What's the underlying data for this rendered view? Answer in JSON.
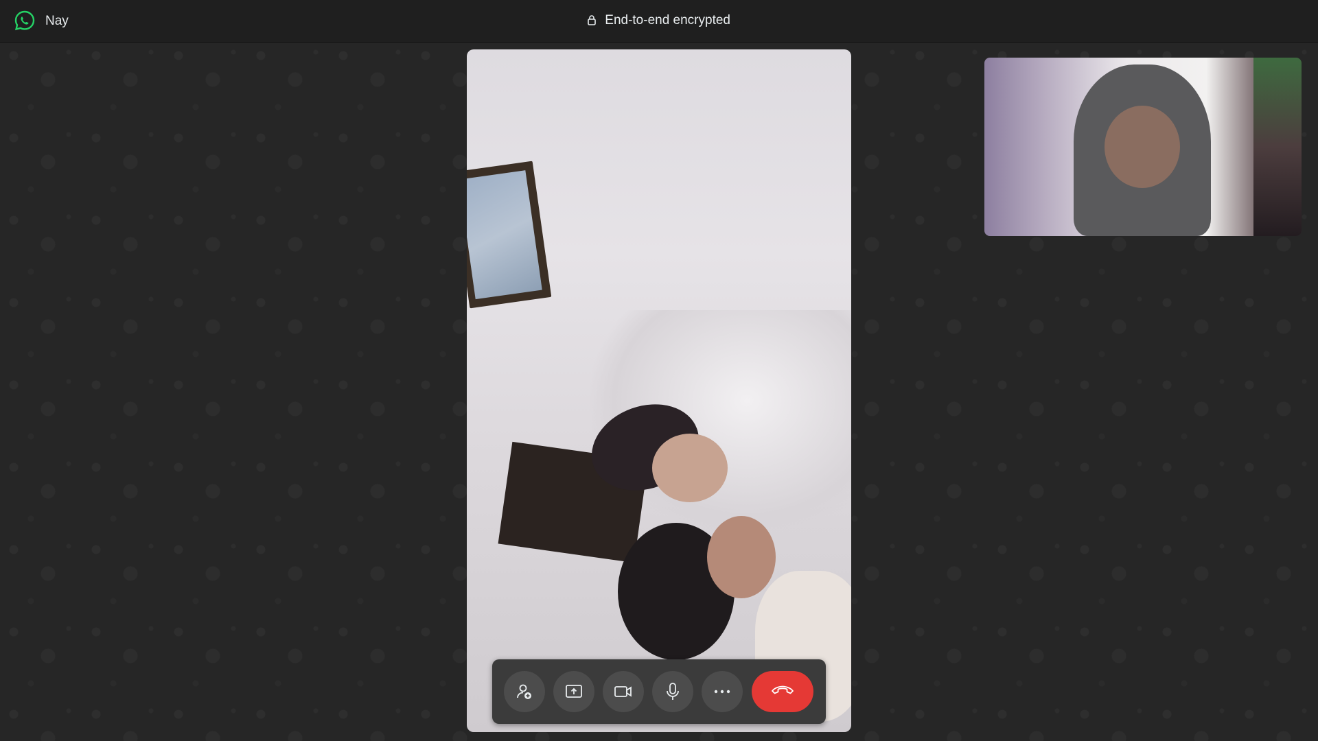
{
  "window": {
    "contact_name": "Nay",
    "encryption_status": "End-to-end encrypted",
    "app_icon": "whatsapp-logo-icon",
    "lock_icon": "lock-icon"
  },
  "controls": {
    "items": [
      {
        "name": "add-participant",
        "icon": "add-person-icon"
      },
      {
        "name": "share-screen",
        "icon": "share-screen-icon"
      },
      {
        "name": "camera",
        "icon": "video-camera-icon"
      },
      {
        "name": "microphone",
        "icon": "microphone-icon"
      },
      {
        "name": "more-options",
        "icon": "more-options-icon"
      },
      {
        "name": "end-call",
        "icon": "hang-up-icon"
      }
    ]
  },
  "colors": {
    "brand": "#25D366",
    "end_call": "#E53935",
    "background": "#262626",
    "titlebar": "#1F1F1F"
  }
}
